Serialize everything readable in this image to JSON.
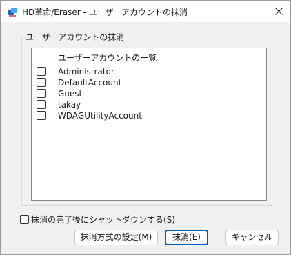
{
  "window": {
    "title": "HD革命/Eraser - ユーザーアカウントの抹消",
    "app_icon": "app-logo-icon",
    "close_icon": "close-icon"
  },
  "group": {
    "legend": "ユーザーアカウントの抹消"
  },
  "account_list": {
    "column_header": "ユーザーアカウントの一覧",
    "items": [
      {
        "label": "Administrator",
        "checked": false
      },
      {
        "label": "DefaultAccount",
        "checked": false
      },
      {
        "label": "Guest",
        "checked": false
      },
      {
        "label": "takay",
        "checked": false
      },
      {
        "label": "WDAGUtilityAccount",
        "checked": false
      }
    ]
  },
  "shutdown_option": {
    "label": "抹消の完了後にシャットダウンする(S)",
    "checked": false
  },
  "buttons": {
    "method": "抹消方式の設定(M)",
    "erase": "抹消(E)",
    "cancel": "キャンセル"
  },
  "colors": {
    "accent": "#005fb8",
    "dialog_background": "#f0f0f0",
    "title_background": "#ffffff"
  }
}
